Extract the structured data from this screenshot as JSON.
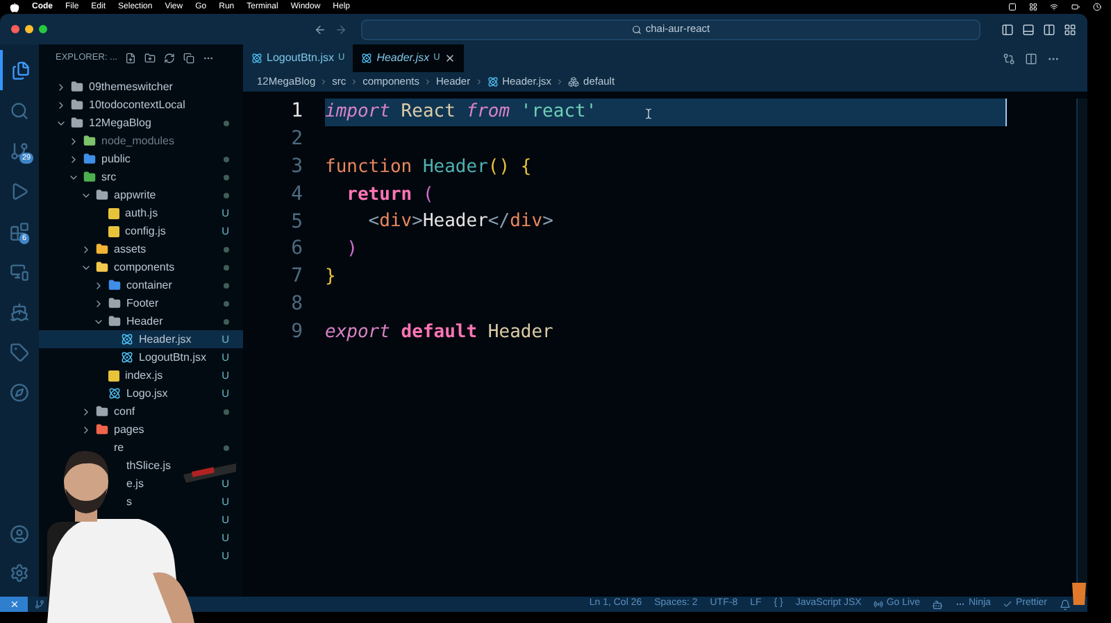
{
  "menu_bar": {
    "items": [
      {
        "label": "Code",
        "bold": true
      },
      {
        "label": "File",
        "bold": false
      },
      {
        "label": "Edit",
        "bold": false
      },
      {
        "label": "Selection",
        "bold": false
      },
      {
        "label": "View",
        "bold": false
      },
      {
        "label": "Go",
        "bold": false
      },
      {
        "label": "Run",
        "bold": false
      },
      {
        "label": "Terminal",
        "bold": false
      },
      {
        "label": "Window",
        "bold": false
      },
      {
        "label": "Help",
        "bold": false
      }
    ]
  },
  "title_bar": {
    "search": "chai-aur-react"
  },
  "activity_bar": {
    "items": [
      {
        "kind": "files",
        "selected": true
      },
      {
        "kind": "search",
        "selected": false
      },
      {
        "kind": "source-control",
        "selected": false,
        "badge": "29"
      },
      {
        "kind": "run",
        "selected": false
      },
      {
        "kind": "extensions",
        "selected": false,
        "badge": "6"
      },
      {
        "kind": "remote",
        "selected": false
      },
      {
        "kind": "docker",
        "selected": false
      },
      {
        "kind": "tag",
        "selected": false
      },
      {
        "kind": "compass",
        "selected": false
      }
    ],
    "bottom": [
      {
        "kind": "account"
      },
      {
        "kind": "settings"
      }
    ]
  },
  "sidebar": {
    "title": "EXPLORER: ...",
    "tree": [
      {
        "name": "09themeswitcher",
        "kind": "folder",
        "color": "#9aa4ad",
        "expanded": false,
        "dot": false
      },
      {
        "name": "10todocontextLocal",
        "kind": "folder",
        "color": "#9aa4ad",
        "expanded": false,
        "dot": false
      },
      {
        "name": "12MegaBlog",
        "kind": "folder",
        "color": "#9aa4ad",
        "expanded": true,
        "dot": true,
        "children": [
          {
            "name": "node_modules",
            "kind": "folder",
            "color": "#7cc36b",
            "expanded": false,
            "dot": false,
            "dim": true
          },
          {
            "name": "public",
            "kind": "folder",
            "color": "#3f8ee8",
            "expanded": false,
            "dot": true
          },
          {
            "name": "src",
            "kind": "folder",
            "color": "#4caf50",
            "expanded": true,
            "dot": true,
            "children": [
              {
                "name": "appwrite",
                "kind": "folder",
                "color": "#9aa4ad",
                "expanded": true,
                "dot": true,
                "children": [
                  {
                    "name": "auth.js",
                    "kind": "js",
                    "badge": "U"
                  },
                  {
                    "name": "config.js",
                    "kind": "js",
                    "badge": "U"
                  }
                ]
              },
              {
                "name": "assets",
                "kind": "folder",
                "color": "#f2b437",
                "expanded": false,
                "dot": true
              },
              {
                "name": "components",
                "kind": "folder",
                "color": "#f2c94c",
                "expanded": true,
                "dot": true,
                "children": [
                  {
                    "name": "container",
                    "kind": "folder",
                    "color": "#3f8ee8",
                    "expanded": false,
                    "dot": true
                  },
                  {
                    "name": "Footer",
                    "kind": "folder",
                    "color": "#9aa4ad",
                    "expanded": false,
                    "dot": true
                  },
                  {
                    "name": "Header",
                    "kind": "folder",
                    "color": "#9aa4ad",
                    "expanded": true,
                    "dot": true,
                    "children": [
                      {
                        "name": "Header.jsx",
                        "kind": "jsx",
                        "badge": "U",
                        "selected": true
                      },
                      {
                        "name": "LogoutBtn.jsx",
                        "kind": "jsx",
                        "badge": "U",
                        "selected": false
                      }
                    ]
                  },
                  {
                    "name": "index.js",
                    "kind": "js",
                    "badge": "U"
                  },
                  {
                    "name": "Logo.jsx",
                    "kind": "jsx",
                    "badge": "U",
                    "selected": false
                  }
                ]
              },
              {
                "name": "conf",
                "kind": "folder",
                "color": "#9aa4ad",
                "expanded": false,
                "dot": true
              },
              {
                "name": "pages",
                "kind": "folder",
                "color": "#f0644b",
                "expanded": false,
                "dot": false
              },
              {
                "name": "re",
                "kind": "text",
                "dot": true,
                "children": [
                  {
                    "name": "thSlice.js",
                    "kind": "text"
                  },
                  {
                    "name": "e.js",
                    "kind": "text",
                    "badge": "U"
                  },
                  {
                    "name": "s",
                    "kind": "text",
                    "badge": "U"
                  },
                  {
                    "kind": "text",
                    "badge": "U"
                  },
                  {
                    "kind": "text",
                    "badge": "U"
                  },
                  {
                    "kind": "text",
                    "badge": "U"
                  }
                ]
              }
            ]
          }
        ]
      }
    ]
  },
  "editor": {
    "tabs": [
      {
        "label": "LogoutBtn.jsx",
        "badge": "U",
        "selected": false
      },
      {
        "label": "Header.jsx",
        "badge": "U",
        "selected": true
      }
    ],
    "breadcrumbs": [
      {
        "label": "12MegaBlog",
        "kind": "text"
      },
      {
        "label": "src",
        "kind": "text"
      },
      {
        "label": "components",
        "kind": "text"
      },
      {
        "label": "Header",
        "kind": "text"
      },
      {
        "label": "Header.jsx",
        "kind": "react"
      },
      {
        "label": "default",
        "kind": "symbol"
      }
    ],
    "lines": [
      {
        "number": "1",
        "selected": true,
        "tokens": [
          {
            "text": "import",
            "kind": "kw-italic"
          },
          {
            "text": " React ",
            "kind": "ident"
          },
          {
            "text": "from",
            "kind": "kw-italic"
          },
          {
            "text": " 'react'",
            "kind": "string"
          }
        ]
      },
      {
        "number": "2",
        "selected": false
      },
      {
        "number": "3",
        "selected": false,
        "tokens": [
          {
            "text": "function",
            "kind": "decl"
          },
          {
            "text": " Header",
            "kind": "fn"
          },
          {
            "text": "()",
            "kind": "paren"
          },
          {
            "text": " {",
            "kind": "paren"
          }
        ]
      },
      {
        "number": "4",
        "selected": false,
        "tokens": [
          {
            "text": "  return",
            "kind": "kw-bold"
          },
          {
            "text": " (",
            "kind": "paren2"
          }
        ]
      },
      {
        "number": "5",
        "selected": false,
        "tokens": [
          {
            "text": "    <",
            "kind": "punct"
          },
          {
            "text": "div",
            "kind": "tag"
          },
          {
            "text": ">",
            "kind": "punct"
          },
          {
            "text": "Header",
            "kind": "plain"
          },
          {
            "text": "</",
            "kind": "punct"
          },
          {
            "text": "div",
            "kind": "tag"
          },
          {
            "text": ">",
            "kind": "punct"
          }
        ]
      },
      {
        "number": "6",
        "selected": false,
        "tokens": [
          {
            "text": "  )",
            "kind": "paren2"
          }
        ]
      },
      {
        "number": "7",
        "selected": false,
        "tokens": [
          {
            "text": "}",
            "kind": "paren"
          }
        ]
      },
      {
        "number": "8",
        "selected": false
      },
      {
        "number": "9",
        "selected": false,
        "tokens": [
          {
            "text": "export",
            "kind": "kw-italic"
          },
          {
            "text": " default",
            "kind": "kw-bold"
          },
          {
            "text": " Header",
            "kind": "ident"
          }
        ]
      }
    ]
  },
  "status_bar": {
    "items": [
      {
        "label": "Ln 1, Col 26",
        "kind": "text"
      },
      {
        "label": "Spaces: 2",
        "kind": "text"
      },
      {
        "label": "UTF-8",
        "kind": "text"
      },
      {
        "label": "LF",
        "kind": "text"
      },
      {
        "label": "{ }",
        "kind": "text"
      },
      {
        "label": "JavaScript JSX",
        "kind": "text"
      },
      {
        "label": "Go Live",
        "kind": "golive"
      },
      {
        "kind": "copilot"
      },
      {
        "label": "Ninja",
        "kind": "ninja"
      },
      {
        "label": "Prettier",
        "kind": "prettier"
      },
      {
        "kind": "bell"
      }
    ]
  }
}
